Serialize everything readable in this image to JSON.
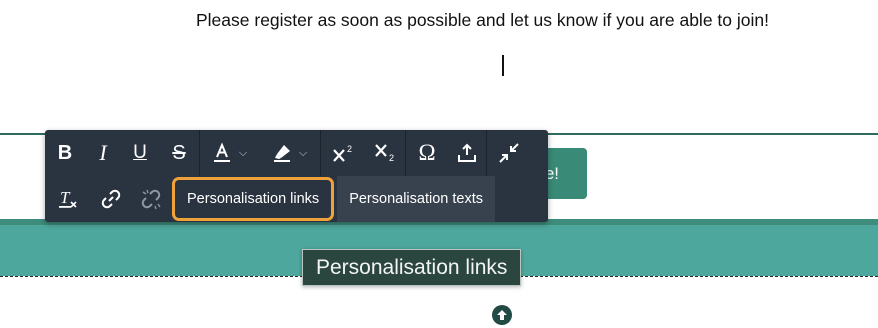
{
  "editor": {
    "paragraph": "Please register as soon as possible and let us know if you are able to join!"
  },
  "cta_button": {
    "visible_text": "e!"
  },
  "toolbar": {
    "row1": [
      {
        "name": "bold-button",
        "glyph": "B"
      },
      {
        "name": "italic-button",
        "glyph": "I"
      },
      {
        "name": "underline-button",
        "glyph": "U"
      },
      {
        "name": "strikethrough-button",
        "glyph": "S"
      },
      {
        "name": "text-color-button",
        "icon": "text-color-icon"
      },
      {
        "name": "highlight-color-button",
        "icon": "highlighter-icon"
      },
      {
        "name": "superscript-button",
        "glyph": "X",
        "sup": "2"
      },
      {
        "name": "subscript-button",
        "glyph": "X",
        "sub": "2"
      },
      {
        "name": "special-character-button",
        "glyph": "Ω"
      },
      {
        "name": "upload-button",
        "icon": "upload-icon"
      },
      {
        "name": "collapse-button",
        "icon": "collapse-arrows-icon"
      }
    ],
    "row2": {
      "clear_format_glyph": "T",
      "personalisation_links_label": "Personalisation links",
      "personalisation_texts_label": "Personalisation texts"
    }
  },
  "tooltip": {
    "text": "Personalisation links"
  },
  "colors": {
    "toolbar_bg": "#2a3340",
    "teal_band": "#4ea79c",
    "cta_bg": "#3a8a78",
    "focus_ring": "#f0a23a",
    "tooltip_bg": "#2b463f"
  }
}
